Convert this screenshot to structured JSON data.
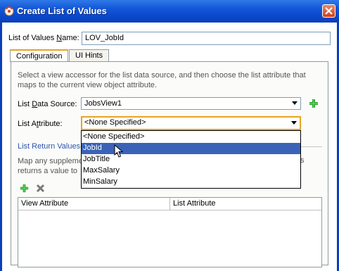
{
  "window": {
    "title": "Create List of Values",
    "close_icon": "close-icon",
    "app_icon": "jdeveloper-icon"
  },
  "form": {
    "name_label_pre": "List of Values ",
    "name_label_u": "N",
    "name_label_post": "ame:",
    "name_value": "LOV_JobId"
  },
  "tabs": [
    {
      "label": "Configuration",
      "active": true
    },
    {
      "label": "UI Hints",
      "active": false
    }
  ],
  "config": {
    "description": "Select a view accessor for the list data source, and then choose the list attribute that maps to the current view object attribute.",
    "data_source_label_pre": "List ",
    "data_source_label_u": "D",
    "data_source_label_post": "ata Source:",
    "data_source_value": "JobsView1",
    "attribute_label_pre": "List A",
    "attribute_label_u": "t",
    "attribute_label_post": "tribute:",
    "attribute_value": "<None Specified>",
    "return_values_title": "List Return Values",
    "map_text_line1": "Map any suppleme",
    "map_text_line2": "returns a value to",
    "map_text_tail": "s"
  },
  "dropdown": {
    "options": [
      "<None Specified>",
      "JobId",
      "JobTitle",
      "MaxSalary",
      "MinSalary"
    ],
    "selected_index": 1
  },
  "table": {
    "columns": [
      "View Attribute",
      "List Attribute"
    ]
  },
  "colors": {
    "titlebar": "#0a3fb8",
    "accent_focus": "#e8a322",
    "selection": "#3a63b8",
    "add_green": "#2aa22a"
  }
}
